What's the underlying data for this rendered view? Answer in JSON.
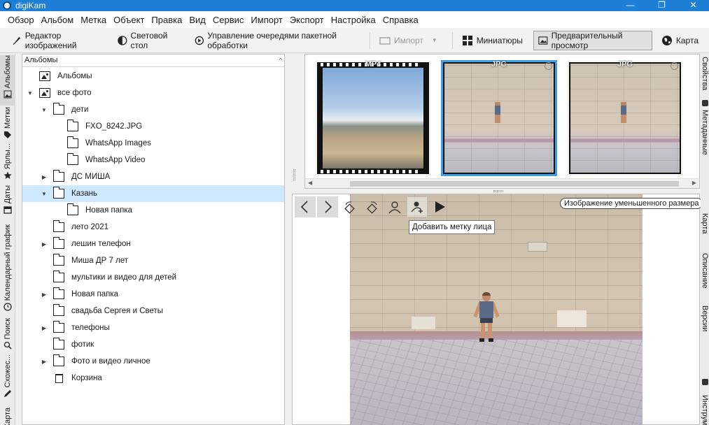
{
  "window": {
    "title": "digiKam",
    "controls": [
      "—",
      "❐",
      "✕"
    ]
  },
  "menu": [
    "Обзор",
    "Альбом",
    "Метка",
    "Объект",
    "Правка",
    "Вид",
    "Сервис",
    "Импорт",
    "Экспорт",
    "Настройка",
    "Справка"
  ],
  "toolbar": {
    "editor": "Редактор изображений",
    "lighttable": "Световой стол",
    "batch_queue": "Управление очередями пакетной обработки",
    "import": "Импорт",
    "thumbnails": "Миниатюры",
    "preview": "Предварительный просмотр",
    "map": "Карта"
  },
  "left_tabs": [
    "Альбомы",
    "Метки",
    "Ярлы...",
    "Даты",
    "Календарный график",
    "Поиск",
    "Схожес...",
    "Карта"
  ],
  "album_panel": {
    "header": "Альбомы",
    "tree": [
      {
        "label": "Альбомы",
        "level": 0,
        "icon": "image",
        "expander": ""
      },
      {
        "label": "все фото",
        "level": 0,
        "icon": "image",
        "expander": "open"
      },
      {
        "label": "дети",
        "level": 1,
        "icon": "folder",
        "expander": "open"
      },
      {
        "label": "FXO_8242.JPG",
        "level": 2,
        "icon": "folder",
        "expander": ""
      },
      {
        "label": "WhatsApp Images",
        "level": 2,
        "icon": "folder",
        "expander": ""
      },
      {
        "label": "WhatsApp Video",
        "level": 2,
        "icon": "folder",
        "expander": ""
      },
      {
        "label": "ДС МИША",
        "level": 1,
        "icon": "folder",
        "expander": "closed"
      },
      {
        "label": "Казань",
        "level": 1,
        "icon": "folder",
        "expander": "open",
        "selected": true
      },
      {
        "label": "Новая папка",
        "level": 2,
        "icon": "folder",
        "expander": ""
      },
      {
        "label": "лето 2021",
        "level": 1,
        "icon": "folder",
        "expander": ""
      },
      {
        "label": "лешин телефон",
        "level": 1,
        "icon": "folder",
        "expander": "closed"
      },
      {
        "label": "Миша ДР 7 лет",
        "level": 1,
        "icon": "folder",
        "expander": ""
      },
      {
        "label": "мультики и видео для детей",
        "level": 1,
        "icon": "folder",
        "expander": ""
      },
      {
        "label": "Новая папка",
        "level": 1,
        "icon": "folder",
        "expander": "closed"
      },
      {
        "label": "свадьба Сергея и Светы",
        "level": 1,
        "icon": "folder",
        "expander": ""
      },
      {
        "label": "телефоны",
        "level": 1,
        "icon": "folder",
        "expander": "closed"
      },
      {
        "label": "фотик",
        "level": 1,
        "icon": "folder",
        "expander": ""
      },
      {
        "label": "Фото и видео личное",
        "level": 1,
        "icon": "folder",
        "expander": "closed"
      },
      {
        "label": "Корзина",
        "level": 1,
        "icon": "trash",
        "expander": ""
      }
    ]
  },
  "thumbnails": [
    {
      "format": "MP4",
      "kind": "video",
      "selected": false,
      "gps": false
    },
    {
      "format": "JPG",
      "kind": "photo",
      "selected": true,
      "gps": true
    },
    {
      "format": "JPG",
      "kind": "photo",
      "selected": false,
      "gps": true
    }
  ],
  "preview": {
    "tooltip": "Добавить метку лица",
    "reduced_badge": "Изображение уменьшенного размера"
  },
  "right_tabs": [
    "Свойства",
    "Метаданные",
    "Карта",
    "Описание",
    "Версии",
    "Инструменты"
  ],
  "colors": {
    "accent": "#3da0e8",
    "selection": "#cde8ff",
    "titlebar": "#1e7fd6"
  }
}
